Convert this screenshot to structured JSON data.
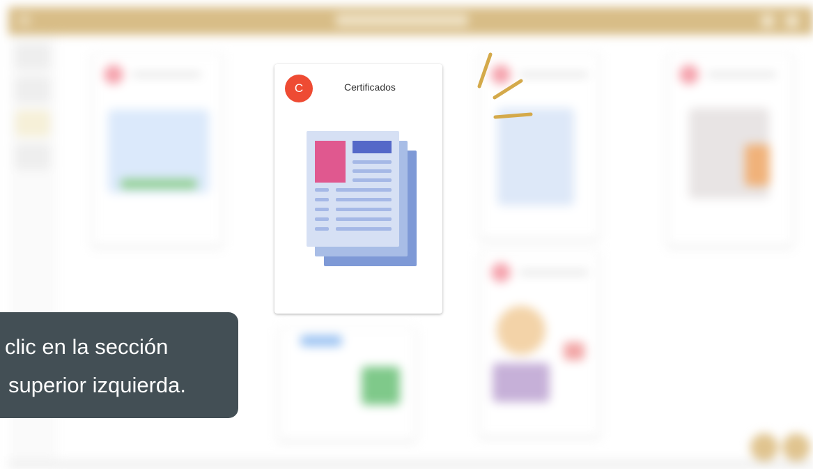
{
  "focused_card": {
    "avatar_letter": "C",
    "title": "Certificados",
    "avatar_color": "#ee4b33",
    "illustration": "document-stack-icon"
  },
  "tooltip": {
    "line1": "clic en la sección",
    "line2": "superior izquierda."
  },
  "colors": {
    "header": "#d8bd87",
    "tooltip_bg": "#434f55",
    "accent_red": "#ee4b33",
    "spark": "#d4a94a"
  }
}
